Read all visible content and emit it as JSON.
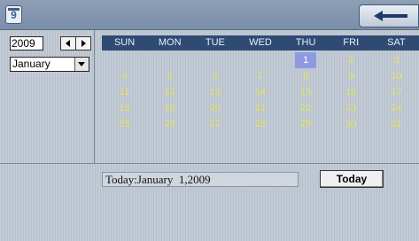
{
  "titlebar": {
    "app_icon_text": "9",
    "icons": [
      "calendar-icon",
      "back-arrow-icon"
    ]
  },
  "controls": {
    "year": "2009",
    "month": "January"
  },
  "calendar": {
    "weekdays": [
      "SUN",
      "MON",
      "TUE",
      "WED",
      "THU",
      "FRI",
      "SAT"
    ],
    "weeks": [
      [
        "",
        "",
        "",
        "",
        "1",
        "2",
        "3"
      ],
      [
        "4",
        "5",
        "6",
        "7",
        "8",
        "9",
        "10"
      ],
      [
        "11",
        "12",
        "13",
        "14",
        "15",
        "16",
        "17"
      ],
      [
        "18",
        "19",
        "20",
        "21",
        "22",
        "23",
        "24"
      ],
      [
        "25",
        "26",
        "27",
        "28",
        "29",
        "30",
        "31"
      ]
    ],
    "selected_day": "1",
    "colors": {
      "header_bg": "#2f4a73",
      "day_text": "#e7e25a",
      "selected_bg": "#8e9ae0"
    }
  },
  "footer": {
    "today_text": "Today:January  1,2009",
    "today_button": "Today"
  }
}
